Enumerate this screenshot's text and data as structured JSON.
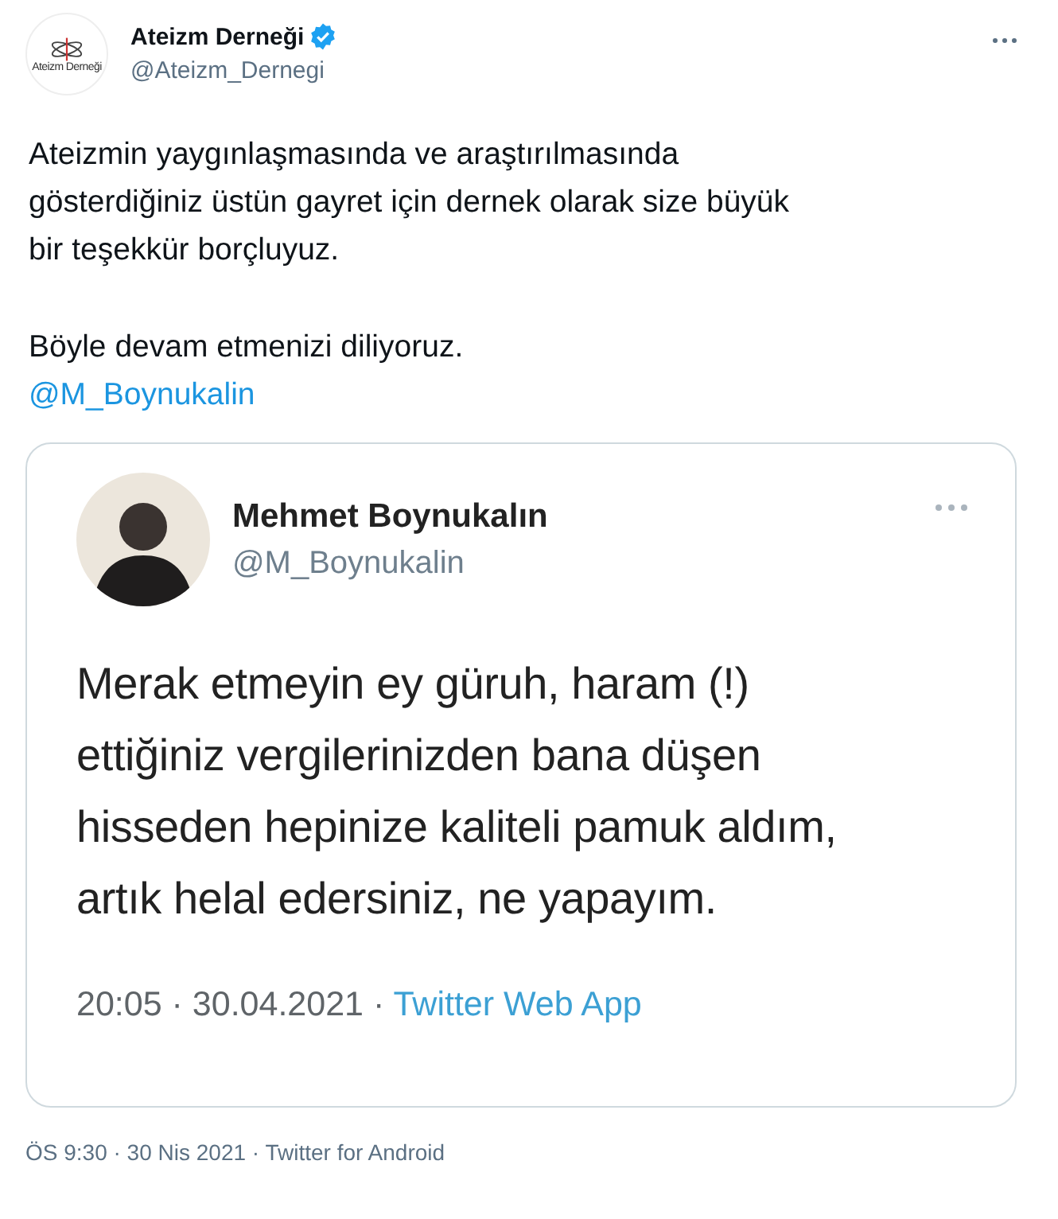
{
  "tweet": {
    "author": {
      "name": "Ateizm Derneği",
      "verified": true,
      "handle": "@Ateizm_Dernegi",
      "logo_text": "Ateizm Derneği"
    },
    "paragraphs": [
      "Ateizmin yaygınlaşmasında ve araştırılmasında\ngösterdiğiniz üstün gayret için dernek olarak size büyük\nbir teşekkür borçluyuz.",
      "Böyle devam etmenizi diliyoruz."
    ],
    "mention": "@M_Boynukalin",
    "embedded_screenshot": {
      "author": {
        "name": "Mehmet Boynukalın",
        "handle": "@M_Boynukalin"
      },
      "text": "Merak etmeyin ey güruh, haram (!)\nettiğiniz vergilerinizden bana düşen\nhisseden hepinize kaliteli pamuk aldım,\nartık helal edersiniz, ne yapayım.",
      "time": "20:05 · 30.04.2021 · ",
      "source": "Twitter Web App"
    },
    "meta": "ÖS 9:30 · 30 Nis 2021 · Twitter for Android"
  }
}
